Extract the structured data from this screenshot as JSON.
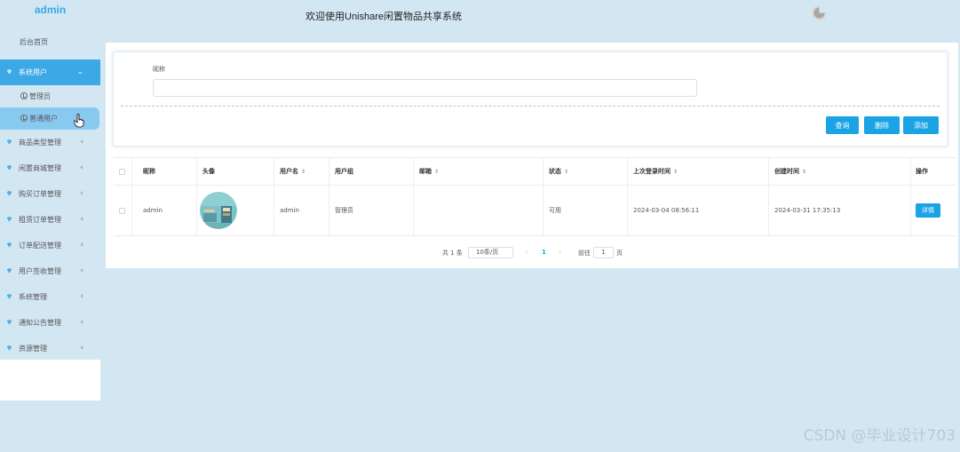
{
  "app": {
    "brand": "admin",
    "header_title": "欢迎使用Unishare闲置物品共享系统"
  },
  "sidebar": {
    "home": "后台首页",
    "menus": [
      {
        "label": "系统用户",
        "expanded": true,
        "icon": "gem-icon"
      },
      {
        "label": "商品类型管理",
        "icon": "gem-icon"
      },
      {
        "label": "闲置商城管理",
        "icon": "gem-icon"
      },
      {
        "label": "购买订单管理",
        "icon": "gem-icon"
      },
      {
        "label": "租赁订单管理",
        "icon": "gem-icon"
      },
      {
        "label": "订单配送管理",
        "icon": "gem-icon"
      },
      {
        "label": "用户签收管理",
        "icon": "gem-icon"
      },
      {
        "label": "系统管理",
        "icon": "gem-icon"
      },
      {
        "label": "通知公告管理",
        "icon": "gem-icon"
      },
      {
        "label": "资源管理",
        "icon": "gem-icon"
      }
    ],
    "submenu": [
      {
        "label": "管理员"
      },
      {
        "label": "普通用户",
        "selected": true
      }
    ]
  },
  "search": {
    "label": "昵称",
    "value": "",
    "buttons": {
      "query": "查询",
      "delete": "删除",
      "add": "添加"
    }
  },
  "table": {
    "headers": {
      "nickname": "昵称",
      "avatar": "头像",
      "username": "用户名",
      "group": "用户组",
      "email": "邮箱",
      "status": "状态",
      "last_login": "上次登录时间",
      "created": "创建时间",
      "action": "操作"
    },
    "rows": [
      {
        "nickname": "admin",
        "username": "admin",
        "group": "管理员",
        "email": "",
        "status": "可用",
        "last_login": "2024-03-04 08:56:11",
        "created": "2024-03-31 17:35:13",
        "action": "详情"
      }
    ]
  },
  "pagination": {
    "total": "共 1 条",
    "page_size": "10条/页",
    "current_page": "1",
    "goto_label": "前往",
    "goto_value": "1",
    "page_unit": "页"
  },
  "watermark": "CSDN @毕业设计703",
  "colors": {
    "accent": "#1aa4e6",
    "sidebar_active": "#3ca8e6",
    "background": "#d3e7f3"
  }
}
